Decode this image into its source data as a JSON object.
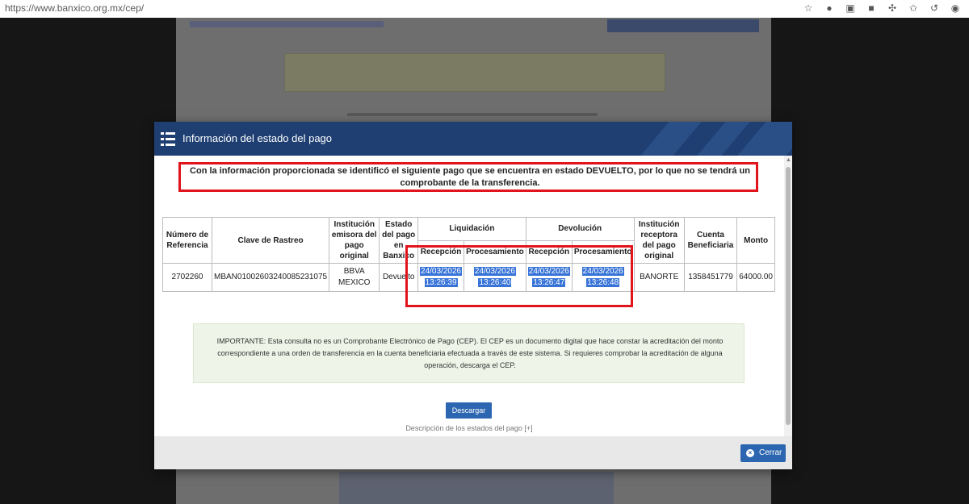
{
  "browser": {
    "url": "https://www.banxico.org.mx/cep/"
  },
  "modal": {
    "title": "Información del estado del pago",
    "alert": "Con la información proporcionada se identificó el siguiente pago que se encuentra en estado DEVUELTO, por lo que no se tendrá un comprobante de la transferencia.",
    "table": {
      "headers": {
        "numero": "Número de Referencia",
        "clave": "Clave de Rastreo",
        "institucion_emisora": "Institución emisora del pago original",
        "estado": "Estado del pago en Banxico",
        "liquidacion": "Liquidación",
        "devolucion": "Devolución",
        "recepcion": "Recepción",
        "procesamiento": "Procesamiento",
        "institucion_receptora": "Institución receptora del pago original",
        "cuenta": "Cuenta Beneficiaria",
        "monto": "Monto"
      },
      "row": {
        "numero": "2702260",
        "clave": "MBAN01002603240085231075",
        "institucion_emisora": "BBVA MEXICO",
        "estado": "Devuelto",
        "liq_recepcion_fecha": "24/03/2026",
        "liq_recepcion_hora": "13:26:39",
        "liq_procesamiento_fecha": "24/03/2026",
        "liq_procesamiento_hora": "13:26:40",
        "dev_recepcion_fecha": "24/03/2026",
        "dev_recepcion_hora": "13:26:47",
        "dev_procesamiento_fecha": "24/03/2026",
        "dev_procesamiento_hora": "13:26:48",
        "institucion_receptora": "BANORTE",
        "cuenta": "1358451779",
        "monto": "64000.00"
      }
    },
    "important": "IMPORTANTE: Esta consulta no es un Comprobante Electrónico de Pago (CEP). El CEP es un documento digital que hace constar la acreditación del monto correspondiente a una orden de transferencia en la cuenta beneficiaria efectuada a través de este sistema. Si requieres comprobar la acreditación de alguna operación, descarga el CEP.",
    "download_label": "Descargar",
    "states_link": "Descripción de los estados del pago [+]",
    "close_label": "Cerrar"
  },
  "colors": {
    "header": "#1f3f73",
    "button": "#2d66b0",
    "highlight": "#e1141c",
    "selection": "#3874d8"
  },
  "icons": [
    "star-icon",
    "extension-icon",
    "save-icon",
    "shield-icon",
    "puzzle-icon",
    "favorites-icon",
    "history-icon",
    "profile-avatar-icon",
    "list-icon",
    "close-icon"
  ]
}
